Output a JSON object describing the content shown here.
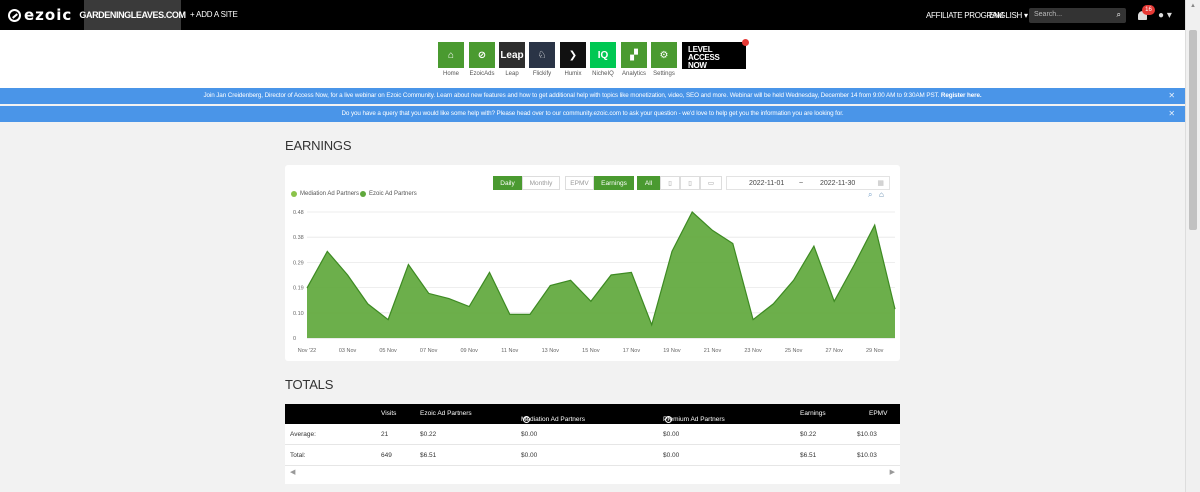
{
  "topbar": {
    "logo": "ezoic",
    "site": "GARDENINGLEAVES.COM",
    "add_site": "+ ADD A SITE",
    "affiliate": "AFFILIATE PROGRAM",
    "language": "ENGLISH",
    "search_placeholder": "Search...",
    "notifications": "16"
  },
  "apps": [
    {
      "label": "Home",
      "color": "#4a9a30",
      "glyph": "⌂"
    },
    {
      "label": "EzoicAds",
      "color": "#4a9a30",
      "glyph": "⊘"
    },
    {
      "label": "Leap",
      "color": "#2e2e2e",
      "glyph": "Leap"
    },
    {
      "label": "Flickify",
      "color": "#2a3446",
      "glyph": "♘"
    },
    {
      "label": "Humix",
      "color": "#111111",
      "glyph": "❯"
    },
    {
      "label": "NicheIQ",
      "color": "#00c853",
      "glyph": "IQ"
    },
    {
      "label": "Analytics",
      "color": "#4a9a30",
      "glyph": "▞"
    },
    {
      "label": "Settings",
      "color": "#4a9a30",
      "glyph": "⚙"
    }
  ],
  "promo_banner": "LEVEL ACCESS NOW",
  "notices": [
    {
      "text": "Join Jan Creidenberg, Director of Access Now, for a live webinar on Ezoic Community. Learn about new features and how to get additional help with topics like monetization, video, SEO and more. Webinar will be held Wednesday, December 14 from 9:00 AM to 9:30AM PST.",
      "link": "Register here."
    },
    {
      "text": "Do you have a query that you would like some help with? Please head over to our community.ezoic.com to ask your question - we'd love to help get you the information you are looking for.",
      "link": ""
    }
  ],
  "earnings": {
    "heading": "EARNINGS",
    "buttons": {
      "daily": "Daily",
      "monthly": "Monthly",
      "epmv": "EPMV",
      "earnings": "Earnings",
      "all": "All"
    },
    "date_from": "2022-11-01",
    "date_sep": "~",
    "date_to": "2022-11-30",
    "legend": [
      "Mediation Ad Partners",
      "Ezoic Ad Partners"
    ]
  },
  "chart_data": {
    "type": "area",
    "ylim": [
      0,
      0.48
    ],
    "yticks": [
      "0",
      "0.10",
      "0.19",
      "0.29",
      "0.38",
      "0.48"
    ],
    "xticks": [
      "Nov '22",
      "03 Nov",
      "05 Nov",
      "07 Nov",
      "09 Nov",
      "11 Nov",
      "13 Nov",
      "15 Nov",
      "17 Nov",
      "19 Nov",
      "21 Nov",
      "23 Nov",
      "25 Nov",
      "27 Nov",
      "29 Nov"
    ],
    "x": [
      "2022-11-01",
      "2022-11-02",
      "2022-11-03",
      "2022-11-04",
      "2022-11-05",
      "2022-11-06",
      "2022-11-07",
      "2022-11-08",
      "2022-11-09",
      "2022-11-10",
      "2022-11-11",
      "2022-11-12",
      "2022-11-13",
      "2022-11-14",
      "2022-11-15",
      "2022-11-16",
      "2022-11-17",
      "2022-11-18",
      "2022-11-19",
      "2022-11-20",
      "2022-11-21",
      "2022-11-22",
      "2022-11-23",
      "2022-11-24",
      "2022-11-25",
      "2022-11-26",
      "2022-11-27",
      "2022-11-28",
      "2022-11-29",
      "2022-11-30"
    ],
    "series": [
      {
        "name": "Mediation Ad Partners",
        "color": "#8bc34a",
        "values": [
          0,
          0,
          0,
          0,
          0,
          0,
          0,
          0,
          0,
          0,
          0,
          0,
          0,
          0,
          0,
          0,
          0,
          0,
          0,
          0,
          0,
          0,
          0,
          0,
          0,
          0,
          0,
          0,
          0,
          0
        ]
      },
      {
        "name": "Ezoic Ad Partners",
        "color": "#5fa83c",
        "values": [
          0.19,
          0.33,
          0.24,
          0.13,
          0.07,
          0.28,
          0.17,
          0.15,
          0.12,
          0.25,
          0.09,
          0.09,
          0.2,
          0.22,
          0.14,
          0.24,
          0.25,
          0.05,
          0.33,
          0.48,
          0.41,
          0.36,
          0.07,
          0.13,
          0.22,
          0.35,
          0.14,
          0.28,
          0.43,
          0.11
        ]
      }
    ]
  },
  "totals": {
    "heading": "TOTALS",
    "columns": [
      "Visits",
      "Ezoic Ad Partners",
      "Mediation Ad Partners",
      "Premium Ad Partners",
      "Earnings",
      "EPMV"
    ],
    "rows": [
      {
        "label": "Average:",
        "values": [
          "21",
          "$0.22",
          "$0.00",
          "$0.00",
          "$0.22",
          "$10.03"
        ]
      },
      {
        "label": "Total:",
        "values": [
          "649",
          "$6.51",
          "$0.00",
          "$0.00",
          "$6.51",
          "$10.03"
        ]
      }
    ]
  }
}
